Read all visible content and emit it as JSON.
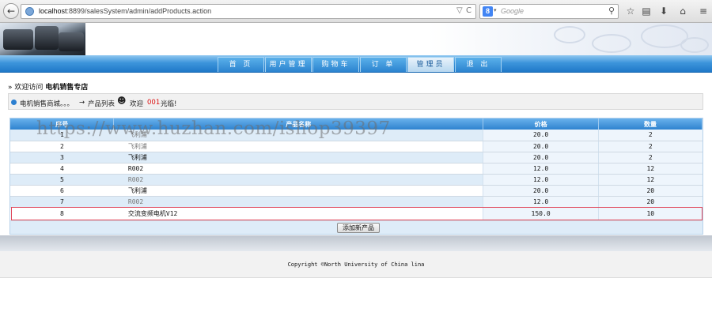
{
  "browser": {
    "url_host": "localhost",
    "url_path": ":8899/salesSystem/admin/addProducts.action",
    "search_engine": "Google",
    "back_glyph": "←",
    "reload_glyph": "C"
  },
  "nav": {
    "tabs": [
      "首 页",
      "用户管理",
      "购物车",
      "订 单",
      "管理员",
      "退 出"
    ],
    "active": "管理员"
  },
  "welcome": {
    "prefix": "欢迎访问",
    "site_name": "电机销售专店"
  },
  "info_bar": {
    "store_link": "电机销售商城。。。",
    "arrow": "→",
    "product_list": "产品列表",
    "welcome": "欢迎",
    "username": "001",
    "suffix": "光临!"
  },
  "table": {
    "headers": [
      "序号",
      "产品名称",
      "价格",
      "数量"
    ],
    "rows": [
      {
        "id": "1",
        "name": "飞利浦",
        "price": "20.0",
        "qty": "2"
      },
      {
        "id": "2",
        "name": "飞利浦",
        "price": "20.0",
        "qty": "2"
      },
      {
        "id": "3",
        "name": "飞利浦",
        "price": "20.0",
        "qty": "2"
      },
      {
        "id": "4",
        "name": "R002",
        "price": "12.0",
        "qty": "12"
      },
      {
        "id": "5",
        "name": "R002",
        "price": "12.0",
        "qty": "12"
      },
      {
        "id": "6",
        "name": "飞利浦",
        "price": "20.0",
        "qty": "20"
      },
      {
        "id": "7",
        "name": "R002",
        "price": "12.0",
        "qty": "20"
      },
      {
        "id": "8",
        "name": "交流变频电机V12",
        "price": "150.0",
        "qty": "10"
      }
    ],
    "add_button": "添加新产品"
  },
  "watermark": "https://www.huzhan.com/ishop39397",
  "footer": {
    "copyright": "Copyright ©North University of China lina"
  },
  "colors": {
    "nav_blue": "#2b83cf",
    "highlight_border": "#e0465a",
    "username_red": "#dd1111"
  }
}
